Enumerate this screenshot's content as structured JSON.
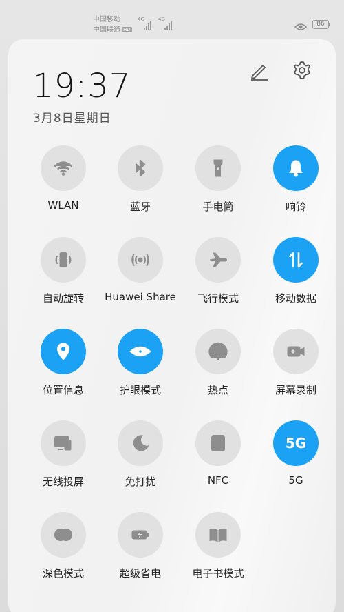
{
  "status_bar": {
    "carrier_1": "中国移动",
    "carrier_2": "中国联通",
    "hd_badge": "HD",
    "signal_1_label": "4G",
    "signal_2_label": "4G",
    "battery_level": "86"
  },
  "header": {
    "time": "19:37",
    "date": "3月8日星期日",
    "edit_icon": "pencil-icon",
    "settings_icon": "gear-icon"
  },
  "tiles": [
    {
      "label": "WLAN",
      "state": "off",
      "icon": "wifi-icon"
    },
    {
      "label": "蓝牙",
      "state": "off",
      "icon": "bluetooth-icon"
    },
    {
      "label": "手电筒",
      "state": "off",
      "icon": "flashlight-icon"
    },
    {
      "label": "响铃",
      "state": "on",
      "icon": "bell-icon"
    },
    {
      "label": "自动旋转",
      "state": "off",
      "icon": "auto-rotate-icon"
    },
    {
      "label": "Huawei Share",
      "state": "off",
      "icon": "huawei-share-icon"
    },
    {
      "label": "飞行模式",
      "state": "off",
      "icon": "airplane-icon"
    },
    {
      "label": "移动数据",
      "state": "on",
      "icon": "mobile-data-icon"
    },
    {
      "label": "位置信息",
      "state": "on",
      "icon": "location-icon"
    },
    {
      "label": "护眼模式",
      "state": "on",
      "icon": "eye-icon"
    },
    {
      "label": "热点",
      "state": "off",
      "icon": "hotspot-icon"
    },
    {
      "label": "屏幕录制",
      "state": "off",
      "icon": "screen-record-icon"
    },
    {
      "label": "无线投屏",
      "state": "off",
      "icon": "wireless-projection-icon"
    },
    {
      "label": "免打扰",
      "state": "off",
      "icon": "moon-icon"
    },
    {
      "label": "NFC",
      "state": "off",
      "icon": "nfc-icon"
    },
    {
      "label": "5G",
      "state": "on",
      "icon": "5g-icon",
      "icon_text": "5G"
    },
    {
      "label": "深色模式",
      "state": "off",
      "icon": "dark-mode-icon"
    },
    {
      "label": "超级省电",
      "state": "off",
      "icon": "super-power-saving-icon"
    },
    {
      "label": "电子书模式",
      "state": "off",
      "icon": "ebook-icon"
    }
  ],
  "colors": {
    "active": "#1ba2f4",
    "inactive": "#e1e1e1",
    "inactive_icon": "#8e8e8e"
  }
}
